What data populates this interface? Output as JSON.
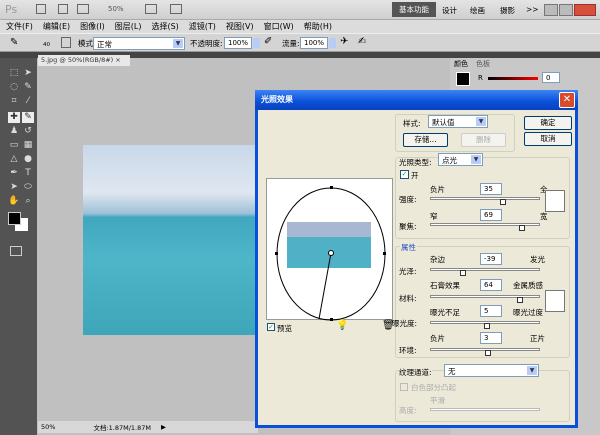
{
  "app": {
    "logo": "Ps",
    "zoom": "50%",
    "workspaces": [
      "基本功能",
      "设计",
      "绘画",
      "摄影"
    ],
    "more": ">>"
  },
  "menu": [
    "文件(F)",
    "编辑(E)",
    "图像(I)",
    "图层(L)",
    "选择(S)",
    "滤镜(T)",
    "视图(V)",
    "窗口(W)",
    "帮助(H)"
  ],
  "options": {
    "brush_size": "40",
    "mode_label": "模式:",
    "mode_value": "正常",
    "opacity_label": "不透明度:",
    "opacity_value": "100%",
    "flow_label": "流量:",
    "flow_value": "100%"
  },
  "document": {
    "tab": "5.jpg @ 50%(RGB/8#)",
    "close": "×"
  },
  "status": {
    "zoom": "50%",
    "doc": "文档:1.87M/1.87M"
  },
  "color_panel": {
    "tabs": [
      "颜色",
      "色板"
    ],
    "channel": "R",
    "value": "0"
  },
  "dialog": {
    "title": "光照效果",
    "style_label": "样式:",
    "style_value": "默认值",
    "save": "存储...",
    "delete": "删除",
    "ok": "确定",
    "cancel": "取消",
    "light_type_label": "光照类型:",
    "light_type_value": "点光",
    "on_label": "开",
    "on_checked": true,
    "intensity": {
      "label": "强度:",
      "left": "负片",
      "right": "全",
      "value": "35"
    },
    "focus": {
      "label": "聚焦:",
      "left": "窄",
      "right": "宽",
      "value": "69"
    },
    "properties_label": "属性",
    "gloss": {
      "label": "光泽:",
      "left": "杂边",
      "right": "发光",
      "value": "-39"
    },
    "material": {
      "label": "材料:",
      "left": "石膏效果",
      "right": "金属质感",
      "value": "64"
    },
    "exposure": {
      "label": "曝光度:",
      "left": "曝光不足",
      "right": "曝光过度",
      "value": "5"
    },
    "ambience": {
      "label": "环境:",
      "left": "负片",
      "right": "正片",
      "value": "3"
    },
    "texture_label": "纹理通道:",
    "texture_value": "无",
    "white_high": "白色部分凸起",
    "height": {
      "label": "高度:",
      "left": "平滑"
    },
    "preview_label": "预览",
    "preview_checked": true
  },
  "colors": {
    "dialog_title": "#0a4fd8",
    "dialog_bg": "#ece9d8",
    "workspace": "#c0c0c0",
    "panel": "#535353"
  }
}
